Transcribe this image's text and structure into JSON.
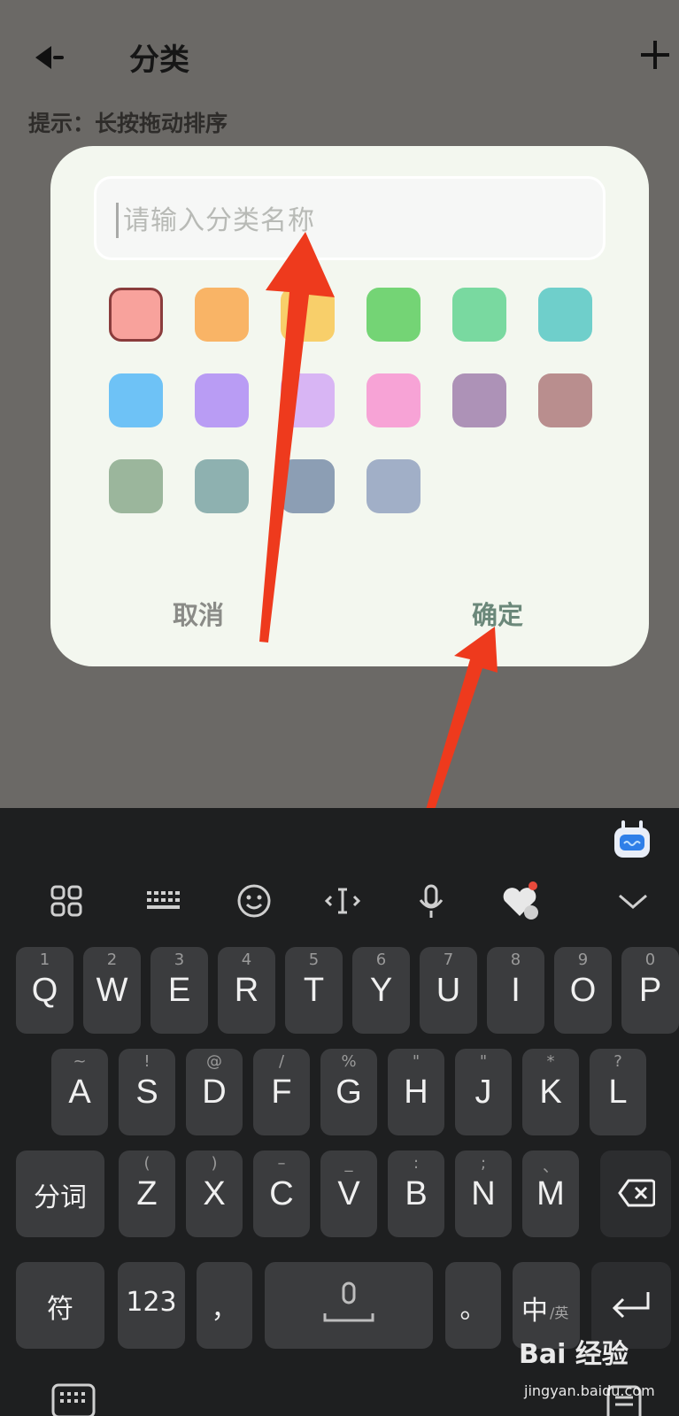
{
  "header": {
    "title": "分类",
    "back_icon": "back-arrow-icon",
    "add_icon": "plus-icon"
  },
  "hint": "提示：长按拖动排序",
  "dialog": {
    "input_placeholder": "请输入分类名称",
    "colors": [
      "#f8a29c",
      "#f9b466",
      "#f8cf6a",
      "#74d475",
      "#79d9a0",
      "#6fcfcb",
      "#6ec2f6",
      "#b99cf4",
      "#d8b5f4",
      "#f7a3d6",
      "#ad92b7",
      "#b98e8e",
      "#9bb69c",
      "#8eb1b0",
      "#8c9eb4",
      "#a1afc7"
    ],
    "selected_color": "#f8a29c",
    "cancel_label": "取消",
    "confirm_label": "确定"
  },
  "keyboard": {
    "toolbar": [
      "apps-grid-icon",
      "keyboard-icon",
      "emoji-icon",
      "cursor-move-icon",
      "microphone-icon",
      "heart-ad-icon",
      "collapse-chevron-icon"
    ],
    "row1": [
      {
        "k": "Q",
        "h": "1"
      },
      {
        "k": "W",
        "h": "2"
      },
      {
        "k": "E",
        "h": "3"
      },
      {
        "k": "R",
        "h": "4"
      },
      {
        "k": "T",
        "h": "5"
      },
      {
        "k": "Y",
        "h": "6"
      },
      {
        "k": "U",
        "h": "7"
      },
      {
        "k": "I",
        "h": "8"
      },
      {
        "k": "O",
        "h": "9"
      },
      {
        "k": "P",
        "h": "0"
      }
    ],
    "row2": [
      {
        "k": "A",
        "h": "~"
      },
      {
        "k": "S",
        "h": "!"
      },
      {
        "k": "D",
        "h": "@"
      },
      {
        "k": "F",
        "h": "/"
      },
      {
        "k": "G",
        "h": "%"
      },
      {
        "k": "H",
        "h": "\""
      },
      {
        "k": "J",
        "h": "\""
      },
      {
        "k": "K",
        "h": "*"
      },
      {
        "k": "L",
        "h": "?"
      }
    ],
    "row3_left": "分词",
    "row3": [
      {
        "k": "Z",
        "h": "("
      },
      {
        "k": "X",
        "h": ")"
      },
      {
        "k": "C",
        "h": "–"
      },
      {
        "k": "V",
        "h": "_"
      },
      {
        "k": "B",
        "h": ":"
      },
      {
        "k": "N",
        "h": ";"
      },
      {
        "k": "M",
        "h": "、"
      }
    ],
    "fu": "符",
    "num": "123",
    "comma": "，",
    "period": "。",
    "lang_main": "中",
    "lang_sub": "/英"
  },
  "watermark": {
    "text": "Bai 经验",
    "sub": "jingyan.baidu.com"
  }
}
